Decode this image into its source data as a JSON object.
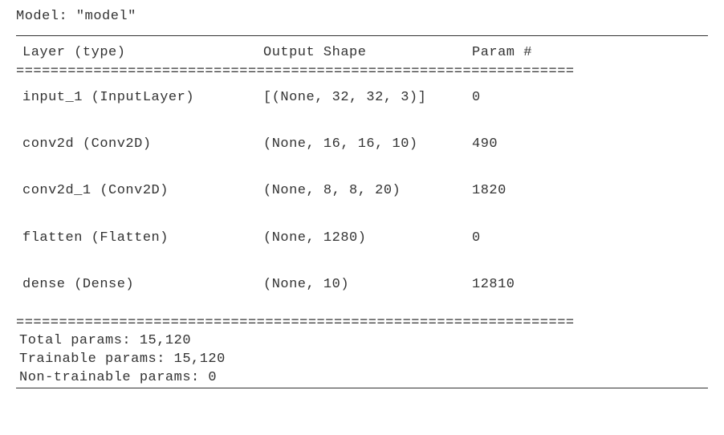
{
  "model_title": "Model: \"model\"",
  "headers": {
    "layer": "Layer (type)",
    "output": "Output Shape",
    "param": "Param #"
  },
  "rows": [
    {
      "layer": "input_1 (InputLayer)",
      "output": "[(None, 32, 32, 3)]",
      "param": "0"
    },
    {
      "layer": "conv2d (Conv2D)",
      "output": "(None, 16, 16, 10)",
      "param": "490"
    },
    {
      "layer": "conv2d_1 (Conv2D)",
      "output": "(None, 8, 8, 20)",
      "param": "1820"
    },
    {
      "layer": "flatten (Flatten)",
      "output": "(None, 1280)",
      "param": "0"
    },
    {
      "layer": "dense (Dense)",
      "output": "(None, 10)",
      "param": "12810"
    }
  ],
  "totals": {
    "total": "Total params: 15,120",
    "trainable": "Trainable params: 15,120",
    "nontrainable": "Non-trainable params: 0"
  },
  "chart_data": {
    "type": "table",
    "title": "Model: \"model\"",
    "columns": [
      "Layer (type)",
      "Output Shape",
      "Param #"
    ],
    "rows": [
      [
        "input_1 (InputLayer)",
        "[(None, 32, 32, 3)]",
        0
      ],
      [
        "conv2d (Conv2D)",
        "(None, 16, 16, 10)",
        490
      ],
      [
        "conv2d_1 (Conv2D)",
        "(None, 8, 8, 20)",
        1820
      ],
      [
        "flatten (Flatten)",
        "(None, 1280)",
        0
      ],
      [
        "dense (Dense)",
        "(None, 10)",
        12810
      ]
    ],
    "summary": {
      "total_params": 15120,
      "trainable_params": 15120,
      "non_trainable_params": 0
    }
  }
}
